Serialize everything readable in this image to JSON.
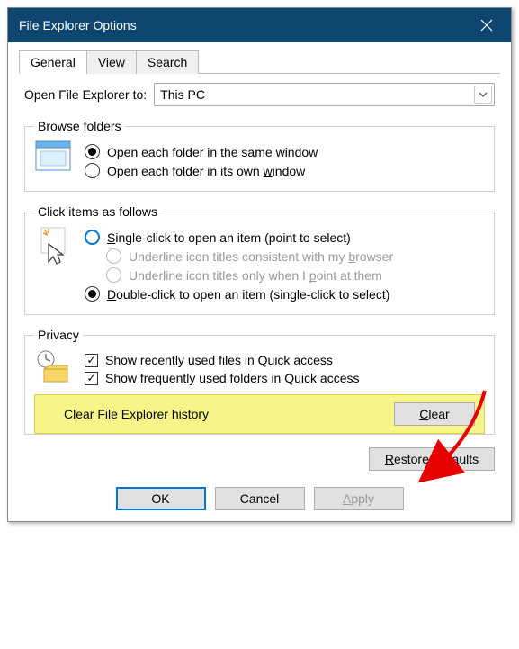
{
  "title": "File Explorer Options",
  "tabs": {
    "general": "General",
    "view": "View",
    "search": "Search"
  },
  "open_to": {
    "label": "Open File Explorer to:",
    "value": "This PC"
  },
  "browse": {
    "legend": "Browse folders",
    "same_pre": "Open each folder in the sa",
    "same_u": "m",
    "same_post": "e window",
    "own_pre": "Open each folder in its own ",
    "own_u": "w",
    "own_post": "indow"
  },
  "click": {
    "legend": "Click items as follows",
    "single_u": "S",
    "single_post": "ingle-click to open an item (point to select)",
    "browser_pre": "Underline icon titles consistent with my ",
    "browser_u": "b",
    "browser_post": "rowser",
    "point_pre": "Underline icon titles only when I ",
    "point_u": "p",
    "point_post": "oint at them",
    "double_u": "D",
    "double_post": "ouble-click to open an item (single-click to select)"
  },
  "privacy": {
    "legend": "Privacy",
    "recent": "Show recently used files in Quick access",
    "frequent": "Show frequently used folders in Quick access",
    "clear_label": "Clear File Explorer history",
    "clear_u": "C",
    "clear_post": "lear"
  },
  "restore_u": "R",
  "restore_post": "estore Defaults",
  "buttons": {
    "ok": "OK",
    "cancel": "Cancel",
    "apply_u": "A",
    "apply_post": "pply"
  }
}
